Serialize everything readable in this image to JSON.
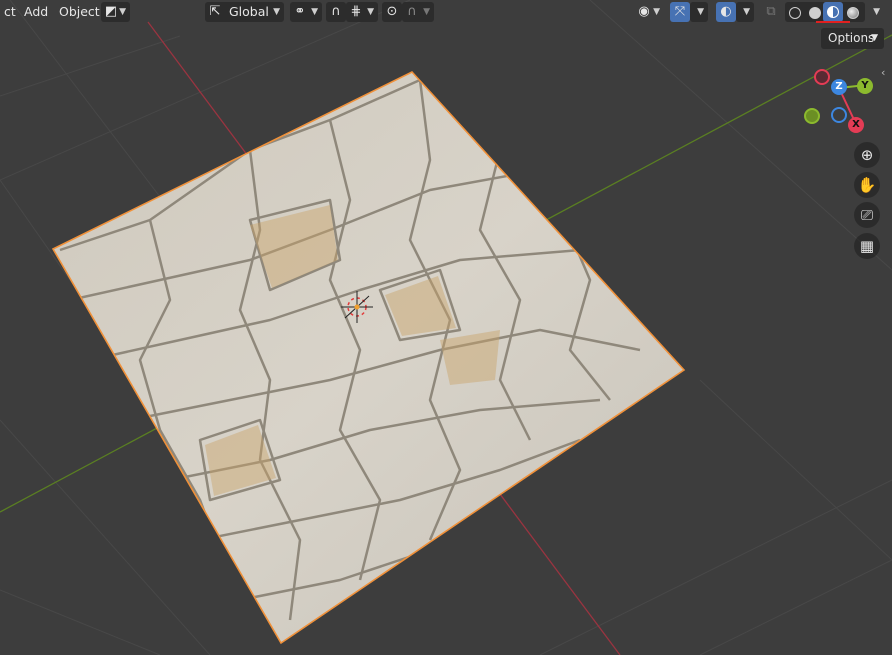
{
  "header": {
    "menus": [
      "ct",
      "Add",
      "Object"
    ],
    "orientation_value": "Global",
    "options_label": "Options"
  },
  "icons": {
    "transform_pivot": "pivot-icon",
    "snap": "magnet-icon",
    "proportional": "proportional-edit-icon",
    "visibility": "eye-icon",
    "gizmo": "gizmo-icon",
    "overlay": "overlay-icon",
    "xray": "xray-icon",
    "shading_wire": "wireframe-shading-icon",
    "shading_solid": "solid-shading-icon",
    "shading_material": "material-shading-icon",
    "shading_rendered": "rendered-shading-icon",
    "nav_zoom": "zoom-icon",
    "nav_pan": "hand-icon",
    "nav_camera": "camera-icon",
    "nav_ortho": "grid-icon"
  },
  "gizmo": {
    "x_label": "X",
    "y_label": "Y",
    "z_label": "Z"
  },
  "colors": {
    "x_axis": "#e43c55",
    "y_axis": "#8cba2e",
    "z_axis": "#3d87e0",
    "selection": "#f0913a",
    "background": "#3d3d3d"
  }
}
